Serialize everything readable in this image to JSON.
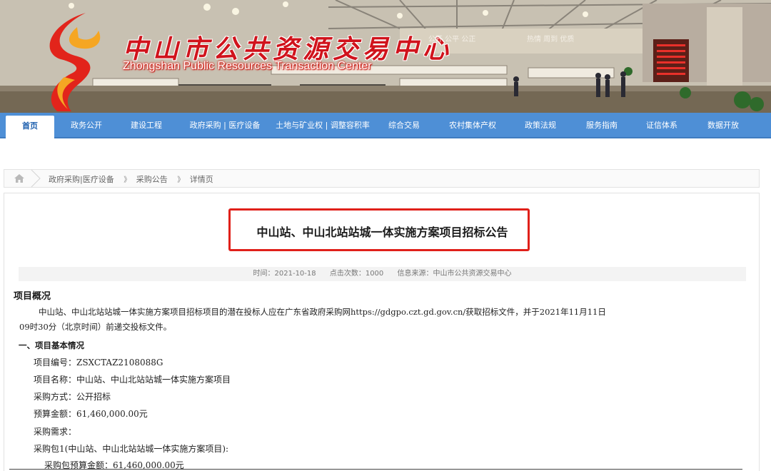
{
  "banner": {
    "title_cn": "中山市公共资源交易中心",
    "title_en": "Zhongshan Public Resources Transaction Center",
    "hall_signs": [
      "公开 公平 公正",
      "热情 周到 优质"
    ],
    "brand_color": "#d0131c"
  },
  "nav": {
    "items": [
      {
        "label": "首页",
        "active": true
      },
      {
        "label": "政务公开"
      },
      {
        "label": "建设工程"
      },
      {
        "label": "政府采购 | 医疗设备"
      },
      {
        "label": "土地与矿业权 | 调整容积率"
      },
      {
        "label": "综合交易"
      },
      {
        "label": "农村集体产权"
      },
      {
        "label": "政策法规"
      },
      {
        "label": "服务指南"
      },
      {
        "label": "证信体系"
      },
      {
        "label": "数据开放"
      }
    ],
    "bg_color": "#4e8fd6"
  },
  "breadcrumb": {
    "home_icon": "home-icon",
    "items": [
      "政府采购|医疗设备",
      "采购公告",
      "详情页"
    ],
    "separator": "》"
  },
  "article": {
    "title": "中山站、中山北站站城一体实施方案项目招标公告",
    "meta": {
      "time": "时间：2021-10-18",
      "clicks": "点击次数：1000",
      "source": "信息来源：中山市公共资源交易中心"
    },
    "overview_heading": "项目概况",
    "overview_text_1": "中山站、中山北站站城一体实施方案项目招标项目的潜在投标人应在广东省政府采购网https://gdgpo.czt.gd.gov.cn/获取招标文件，并于2021年11月11日",
    "overview_text_2": "09时30分（北京时间）前递交投标文件。",
    "section1_heading": "一、项目基本情况",
    "lines": [
      "项目编号：ZSXCTAZ2108088G",
      "项目名称：中山站、中山北站站城一体实施方案项目",
      "采购方式：公开招标",
      "预算金额：61,460,000.00元",
      "采购需求：",
      "采购包1(中山站、中山北站站城一体实施方案项目):",
      "采购包预算金额：61,460,000.00元"
    ],
    "highlight_color": "#e0201a"
  }
}
